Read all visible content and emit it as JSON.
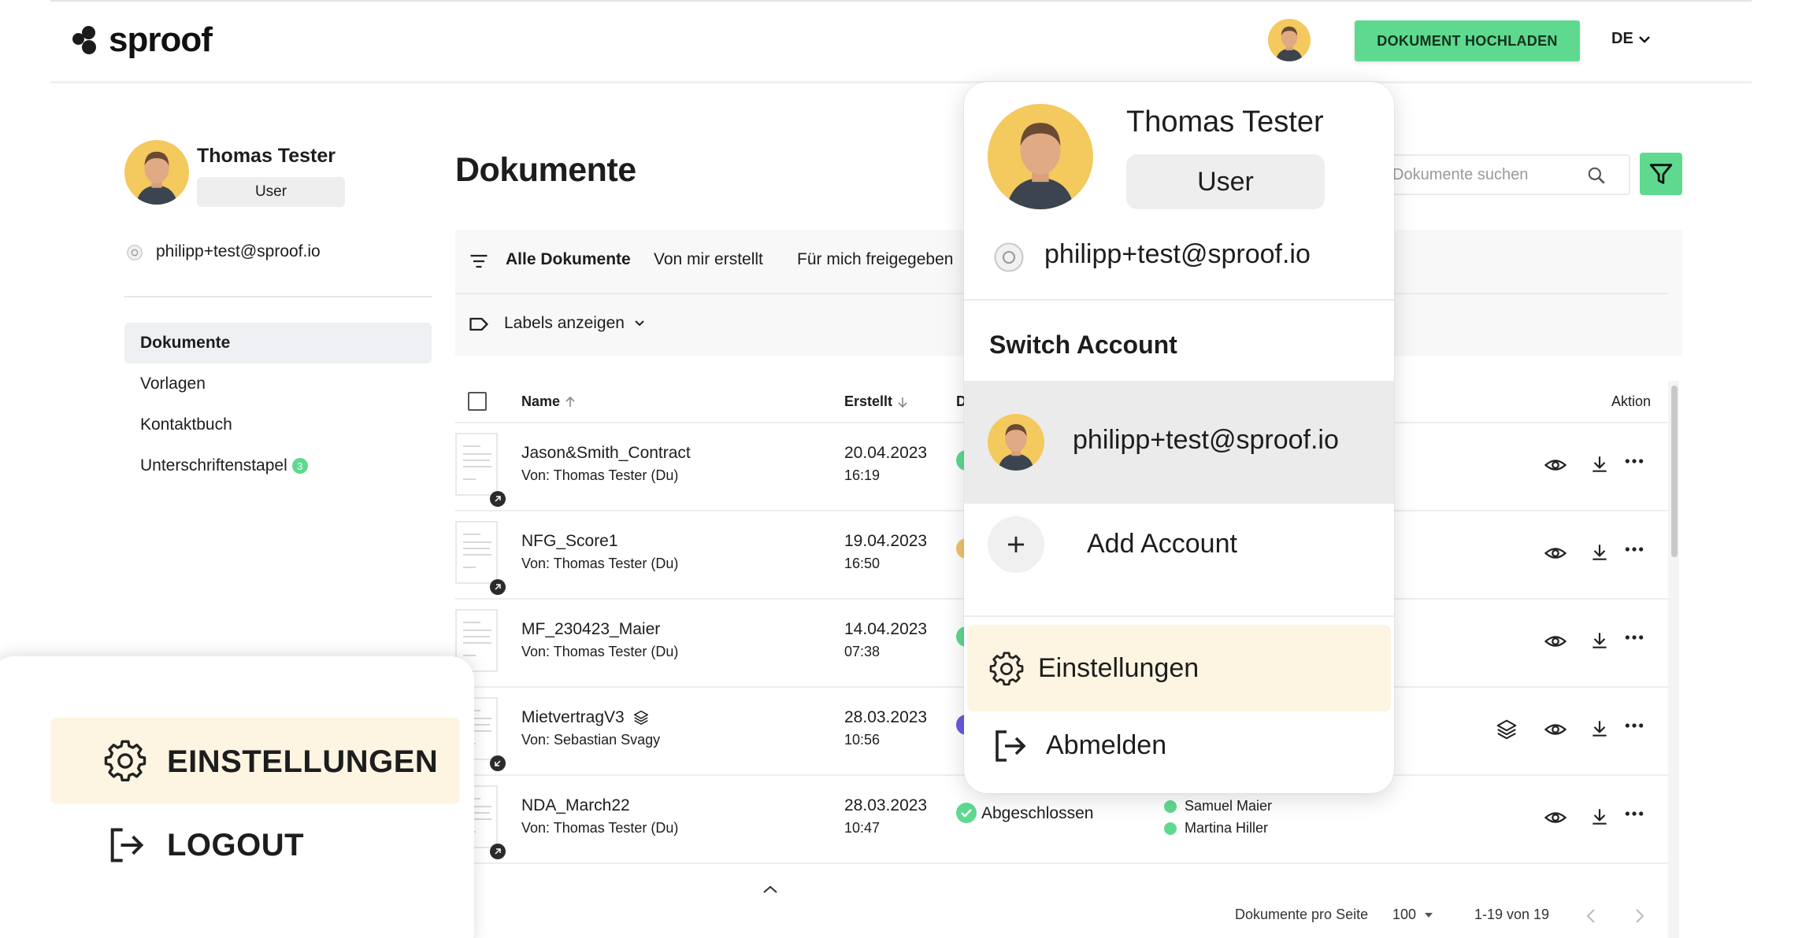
{
  "app": {
    "brand": "sproof",
    "upload_label": "DOKUMENT HOCHLADEN",
    "language": "DE",
    "accent": "#5fd98f"
  },
  "sidebar": {
    "user_name": "Thomas Tester",
    "user_role": "User",
    "email": "philipp+test@sproof.io",
    "items": [
      {
        "label": "Dokumente",
        "active": true
      },
      {
        "label": "Vorlagen",
        "active": false
      },
      {
        "label": "Kontaktbuch",
        "active": false
      },
      {
        "label": "Unterschriftenstapel",
        "active": false,
        "badge": "3"
      }
    ]
  },
  "main": {
    "title": "Dokumente",
    "search_placeholder": "Dokumente suchen",
    "tabs": [
      "Alle Dokumente",
      "Von mir erstellt",
      "Für mich freigegeben"
    ],
    "labels_toggle": "Labels anzeigen",
    "columns": {
      "name": "Name",
      "created": "Erstellt",
      "status": "D",
      "action": "Aktion"
    },
    "rows": [
      {
        "name": "Jason&Smith_Contract",
        "by": "Von: Thomas Tester (Du)",
        "date": "20.04.2023",
        "time": "16:19",
        "status_color": "#5fd98f",
        "badge": "outgoing"
      },
      {
        "name": "NFG_Score1",
        "by": "Von: Thomas Tester (Du)",
        "date": "19.04.2023",
        "time": "16:50",
        "status_color": "#f2c46b",
        "badge": "outgoing"
      },
      {
        "name": "MF_230423_Maier",
        "by": "Von: Thomas Tester (Du)",
        "date": "14.04.2023",
        "time": "07:38",
        "status_color": "#5fd98f",
        "badge": "none"
      },
      {
        "name": "MietvertragV3",
        "by": "Von: Sebastian Svagy",
        "date": "28.03.2023",
        "time": "10:56",
        "status_color": "#6a5ae0",
        "badge": "incoming",
        "stack_icon": true
      },
      {
        "name": "NDA_March22",
        "by": "Von: Thomas Tester (Du)",
        "date": "28.03.2023",
        "time": "10:47",
        "status_color": "#5fd98f",
        "badge": "outgoing",
        "status_text": "Abgeschlossen",
        "signers": [
          "Samuel Maier",
          "Martina Hiller"
        ]
      }
    ],
    "footer": {
      "per_page_label": "Dokumente pro Seite",
      "per_page": "100",
      "range": "1-19 von 19"
    }
  },
  "menu": {
    "user_name": "Thomas Tester",
    "user_role": "User",
    "email": "philipp+test@sproof.io",
    "section_title": "Switch Account",
    "account_email": "philipp+test@sproof.io",
    "add_account": "Add Account",
    "settings": "Einstellungen",
    "logout": "Abmelden"
  },
  "callout": {
    "settings": "EINSTELLUNGEN",
    "logout": "LOGOUT"
  }
}
